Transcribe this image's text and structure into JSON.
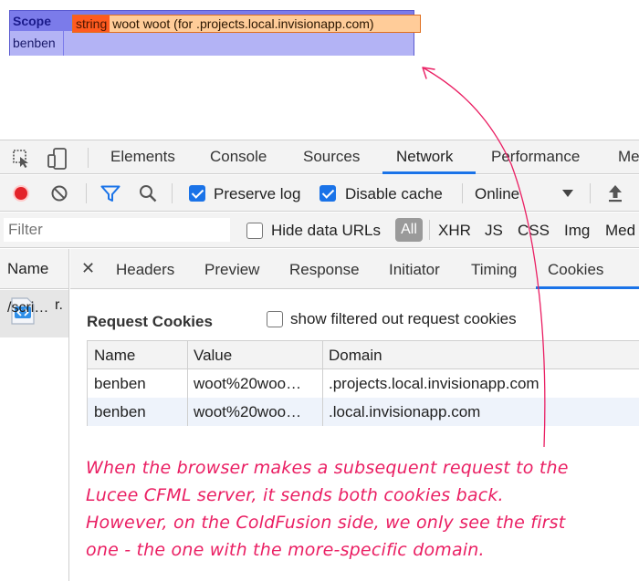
{
  "dump": {
    "title": "Scope",
    "key": "benben",
    "type": "string",
    "value": "woot woot (for .projects.local.invisionapp.com)"
  },
  "devtools": {
    "tabs": [
      "Elements",
      "Console",
      "Sources",
      "Network",
      "Performance",
      "Me"
    ],
    "active_tab": "Network",
    "accent": "#1a73e8"
  },
  "network_toolbar": {
    "preserve_log": "Preserve log",
    "preserve_log_checked": true,
    "disable_cache": "Disable cache",
    "disable_cache_checked": true,
    "throttle": "Online"
  },
  "filter_bar": {
    "placeholder": "Filter",
    "hide_data_urls": "Hide data URLs",
    "types": [
      "All",
      "XHR",
      "JS",
      "CSS",
      "Img",
      "Med"
    ]
  },
  "requests": {
    "header": "Name",
    "item_top": "r.",
    "item_bottom": "/scri…"
  },
  "detail": {
    "tabs": [
      "Headers",
      "Preview",
      "Response",
      "Initiator",
      "Timing",
      "Cookies"
    ],
    "active_tab": "Cookies",
    "section_title": "Request Cookies",
    "show_filtered": "show filtered out request cookies",
    "columns": [
      "Name",
      "Value",
      "Domain"
    ],
    "rows": [
      {
        "name": "benben",
        "value": "woot%20woo…",
        "domain": ".projects.local.invisionapp.com"
      },
      {
        "name": "benben",
        "value": "woot%20woo…",
        "domain": ".local.invisionapp.com"
      }
    ]
  },
  "annotation": {
    "color": "#ea1f63",
    "lines": [
      "When the browser makes a subsequent request to the",
      "Lucee CFML server, it sends both cookies back.",
      "However, on the ColdFusion side, we only see the first",
      "one - the one with the more-specific domain."
    ]
  }
}
